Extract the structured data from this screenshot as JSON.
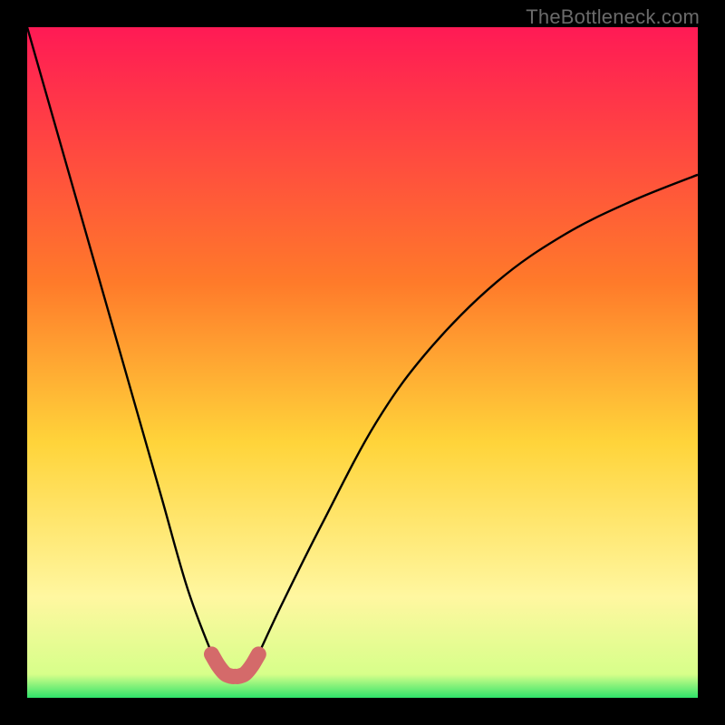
{
  "watermark": "TheBottleneck.com",
  "colors": {
    "frame": "#000000",
    "grad_top": "#ff1a55",
    "grad_mid1": "#ff7a2a",
    "grad_mid2": "#ffd43a",
    "grad_mid3": "#fff7a0",
    "grad_bottom": "#2fe36a",
    "curve": "#000000",
    "valley": "#d46a6a"
  },
  "chart_data": {
    "type": "line",
    "title": "",
    "xlabel": "",
    "ylabel": "",
    "xlim": [
      0,
      100
    ],
    "ylim": [
      0,
      100
    ],
    "annotations": [],
    "series": [
      {
        "name": "bottleneck-curve",
        "x": [
          0,
          4,
          8,
          12,
          16,
          20,
          24,
          28,
          29,
          30,
          31,
          32,
          33,
          34,
          38,
          44,
          52,
          60,
          70,
          80,
          90,
          100
        ],
        "y": [
          100,
          86,
          72,
          58,
          44,
          30,
          16,
          5.5,
          4,
          3.3,
          3.2,
          3.3,
          4,
          5.5,
          14,
          26,
          41,
          52,
          62,
          69,
          74,
          78
        ]
      },
      {
        "name": "valley-marker",
        "x": [
          27.5,
          28.5,
          29.5,
          30.5,
          31,
          31.5,
          32.5,
          33.5,
          34.5
        ],
        "y": [
          6.5,
          4.8,
          3.6,
          3.2,
          3.2,
          3.2,
          3.6,
          4.8,
          6.5
        ]
      }
    ],
    "valley_x_range": [
      27.5,
      34.5
    ],
    "background_gradient_stops": [
      {
        "offset": 0.0,
        "color": "#ff1a55"
      },
      {
        "offset": 0.38,
        "color": "#ff7a2a"
      },
      {
        "offset": 0.62,
        "color": "#ffd43a"
      },
      {
        "offset": 0.85,
        "color": "#fff7a0"
      },
      {
        "offset": 0.965,
        "color": "#d7ff8a"
      },
      {
        "offset": 1.0,
        "color": "#2fe36a"
      }
    ]
  }
}
